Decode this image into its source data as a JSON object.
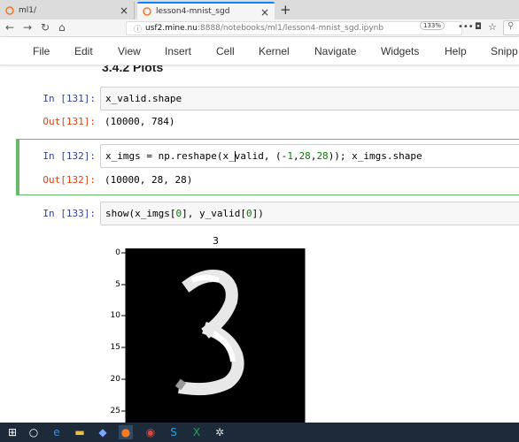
{
  "browser": {
    "tabs": [
      {
        "label": "ml1/"
      },
      {
        "label": "lesson4-mnist_sgd"
      }
    ],
    "url_host": "usf2.mine.nu",
    "url_path": ":8888/notebooks/ml1/lesson4-mnist_sgd.ipynb",
    "zoom": "133%"
  },
  "menu": {
    "items": [
      "File",
      "Edit",
      "View",
      "Insert",
      "Cell",
      "Kernel",
      "Navigate",
      "Widgets",
      "Help",
      "Snipp"
    ]
  },
  "notebook": {
    "section_heading": "3.4.2 Plots",
    "cells": [
      {
        "in_prompt": "In [131]:",
        "code": "x_valid.shape",
        "out_prompt": "Out[131]:",
        "output": "(10000, 784)"
      },
      {
        "in_prompt": "In [132]:",
        "code_parts": [
          "x_imgs = np.reshape(x_",
          "valid, (-",
          "1",
          ",",
          "28",
          ",",
          "28",
          ")); x_imgs.shape"
        ],
        "out_prompt": "Out[132]:",
        "output": "(10000, 28, 28)"
      },
      {
        "in_prompt": "In [133]:",
        "code_parts": [
          "show(x_imgs[",
          "0",
          "], y_valid[",
          "0",
          "])"
        ]
      }
    ]
  },
  "figure": {
    "title": "3",
    "yticks": [
      "0",
      "5",
      "10",
      "15",
      "20",
      "25"
    ]
  },
  "colors": {
    "prompt_in": "#303f9f",
    "prompt_out": "#d84315",
    "selected_border": "#66bb6a",
    "taskbar": "#1c2a3a"
  }
}
